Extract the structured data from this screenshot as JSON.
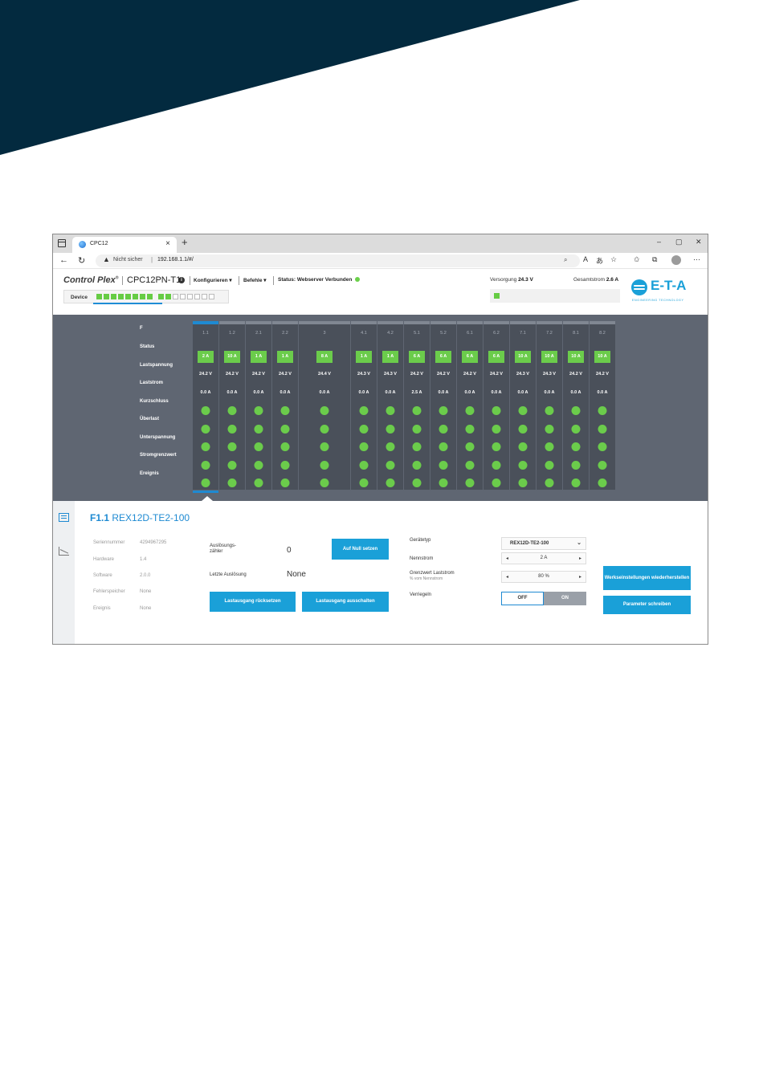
{
  "colors": {
    "banner": "#032a3f",
    "accent": "#1aa0d8",
    "ok_green": "#6bcc4b",
    "panel_bg": "#5f6672",
    "column_bg": "#4a505a"
  },
  "browser": {
    "tab_title": "CPC12",
    "tab_close": "×",
    "new_tab": "+",
    "url_warning": "Nicht sicher",
    "url": "192.168.1.1/#/",
    "window_controls": [
      "–",
      "▢",
      "✕"
    ]
  },
  "app": {
    "brand": "Control Plex",
    "brand_mark": "®",
    "device_name": "CPC12PN-T1",
    "menu_configure": "Konfigurieren",
    "menu_commands": "Befehle",
    "status_label": "Status: Webserver Verbunden",
    "supply_label": "Versorgung",
    "supply_value": "24.3 V",
    "total_label": "Gesamtstrom",
    "total_value": "2.6 A",
    "device_tab": "Device",
    "logo_text": "E-T-A",
    "logo_sub": "ENGINEERING TECHNOLOGY"
  },
  "panel": {
    "row_labels": {
      "f": "F",
      "status": "Status",
      "voltage": "Lastspannung",
      "current": "Laststrom",
      "short": "Kurzschluss",
      "overload": "Überlast",
      "undervoltage": "Unterspannung",
      "limit": "Stromgrenzwert",
      "event": "Ereignis"
    },
    "columns": [
      {
        "id": "1.1",
        "rating": "2 A",
        "voltage": "24.2 V",
        "current": "0.0 A"
      },
      {
        "id": "1.2",
        "rating": "10 A",
        "voltage": "24.2 V",
        "current": "0.0 A"
      },
      {
        "id": "2.1",
        "rating": "1 A",
        "voltage": "24.2 V",
        "current": "0.0 A"
      },
      {
        "id": "2.2",
        "rating": "1 A",
        "voltage": "24.2 V",
        "current": "0.0 A"
      },
      {
        "id": "3",
        "rating": "8 A",
        "voltage": "24.4 V",
        "current": "0.0 A"
      },
      {
        "id": "4.1",
        "rating": "1 A",
        "voltage": "24.3 V",
        "current": "0.0 A"
      },
      {
        "id": "4.2",
        "rating": "1 A",
        "voltage": "24.3 V",
        "current": "0.0 A"
      },
      {
        "id": "5.1",
        "rating": "6 A",
        "voltage": "24.2 V",
        "current": "2.5 A"
      },
      {
        "id": "5.2",
        "rating": "6 A",
        "voltage": "24.2 V",
        "current": "0.0 A"
      },
      {
        "id": "6.1",
        "rating": "6 A",
        "voltage": "24.2 V",
        "current": "0.0 A"
      },
      {
        "id": "6.2",
        "rating": "6 A",
        "voltage": "24.2 V",
        "current": "0.0 A"
      },
      {
        "id": "7.1",
        "rating": "10 A",
        "voltage": "24.3 V",
        "current": "0.0 A"
      },
      {
        "id": "7.2",
        "rating": "10 A",
        "voltage": "24.3 V",
        "current": "0.0 A"
      },
      {
        "id": "8.1",
        "rating": "10 A",
        "voltage": "24.2 V",
        "current": "0.0 A"
      },
      {
        "id": "8.2",
        "rating": "10 A",
        "voltage": "24.2 V",
        "current": "0.0 A"
      }
    ]
  },
  "detail": {
    "title_id": "F1.1",
    "title_model": "REX12D-TE2-100",
    "info": {
      "serial_label": "Seriennummer",
      "serial_value": "4294967295",
      "hardware_label": "Hardware",
      "hardware_value": "1.4",
      "software_label": "Software",
      "software_value": "2.0.0",
      "errmem_label": "Fehlerspeicher",
      "errmem_value": "None",
      "event_label": "Ereignis",
      "event_value": "None"
    },
    "trip_counter_label": "Auslösungs-zähler",
    "trip_counter_value": "0",
    "reset_zero_button": "Auf Null setzen",
    "last_trip_label": "Letzte Auslösung",
    "last_trip_value": "None",
    "reset_output_button": "Lastausgang rücksetzen",
    "switch_off_button": "Lastausgang ausschalten",
    "device_type_label": "Gerätetyp",
    "device_type_value": "REX12D-TE2-100",
    "rated_current_label": "Nennstrom",
    "rated_current_value": "2 A",
    "limit_label": "Grenzwert Laststrom",
    "limit_sub": "% vom Nennstrom",
    "limit_value": "80 %",
    "lock_label": "Verriegeln",
    "lock_off": "OFF",
    "lock_on": "ON",
    "factory_button": "Werkseinstellungen wiederherstellen",
    "write_button": "Parameter schreiben"
  }
}
